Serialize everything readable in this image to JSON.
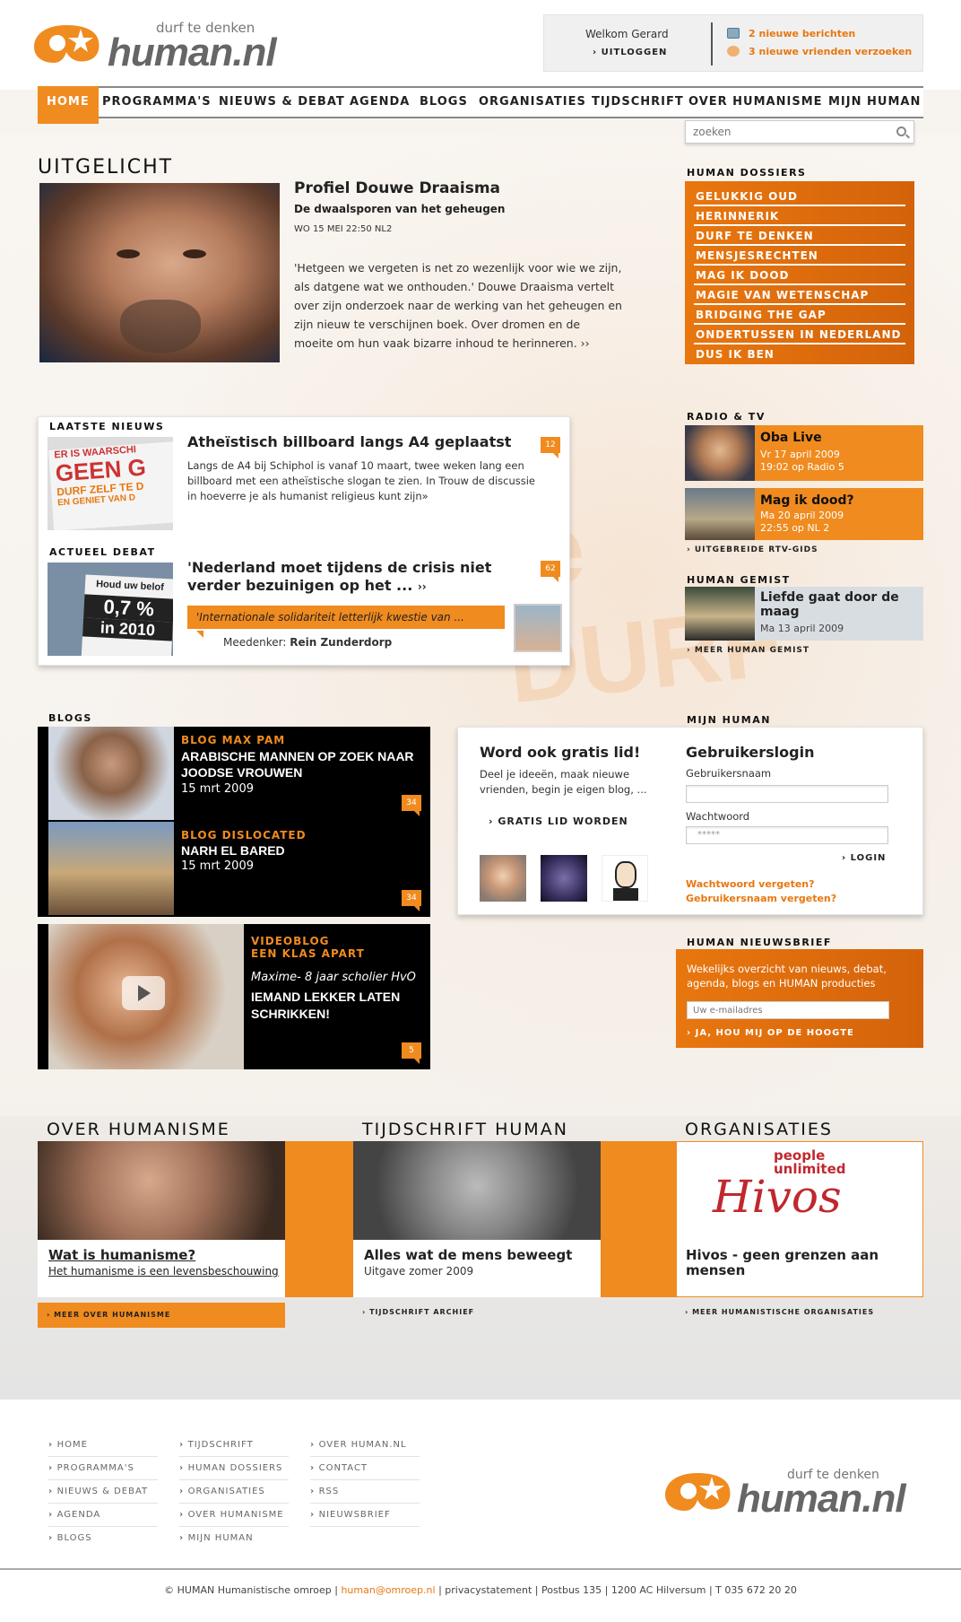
{
  "header": {
    "logo_tagline": "durf te denken",
    "logo_name": "human.nl",
    "welcome": "Welkom Gerard",
    "logout": "UITLOGGEN",
    "messages": "2 nieuwe berichten",
    "friend_requests": "3 nieuwe vrienden verzoeken"
  },
  "nav": {
    "items": [
      "HOME",
      "PROGRAMMA'S",
      "NIEUWS & DEBAT",
      "AGENDA",
      "BLOGS",
      "ORGANISATIES",
      "TIJDSCHRIFT",
      "OVER HUMANISME",
      "MIJN HUMAN"
    ],
    "active": "HOME"
  },
  "search": {
    "placeholder": "zoeken"
  },
  "featured": {
    "section_title": "UITGELICHT",
    "title": "Profiel Douwe Draaisma",
    "subtitle": "De dwaalsporen van het geheugen",
    "meta": "WO 15 MEI 22:50 NL2",
    "body": "'Hetgeen we vergeten is net zo wezenlijk voor wie we zijn, als datgene wat we onthouden.' Douwe Draaisma vertelt over zijn onderzoek naar de werking van het geheugen en zijn nieuw te verschijnen boek. Over dromen en de moeite om hun vaak bizarre inhoud te herinneren. ››"
  },
  "dossiers": {
    "label": "HUMAN DOSSIERS",
    "items": [
      "GELUKKIG OUD",
      "HERINNERIK",
      "DURF TE DENKEN",
      "MENSJESRECHTEN",
      "MAG IK DOOD",
      "MAGIE VAN WETENSCHAP",
      "BRIDGING THE GAP",
      "ONDERTUSSEN IN NEDERLAND",
      "DUS IK BEN"
    ]
  },
  "news": {
    "label": "LAATSTE NIEUWS",
    "title": "Atheïstisch billboard langs A4 geplaatst",
    "count": "12",
    "body": "Langs de A4 bij Schiphol is vanaf 10 maart, twee weken lang een billboard met een atheïstische slogan te zien. In Trouw de discussie in hoeverre je als humanist religieus kunt zijn»",
    "img_lines": [
      "ER IS WAARSCHI",
      "GEEN G",
      "DURF ZELF TE D",
      "EN GENIET VAN D"
    ]
  },
  "debate": {
    "label": "ACTUEEL DEBAT",
    "title": "'Nederland moet tijdens de crisis niet verder bezuinigen op het ...",
    "more": "››",
    "count": "62",
    "quote": "'Internationale solidariteit letterlijk kwestie van ...",
    "debater_label": "Meedenker:",
    "debater": "Rein Zunderdorp",
    "img_lines": [
      "Houd uw belof",
      "0,7 %",
      "in 2010"
    ]
  },
  "radio_tv": {
    "label": "RADIO & TV",
    "items": [
      {
        "title": "Oba Live",
        "line1": "Vr 17 april 2009",
        "line2": "19:02 op Radio 5"
      },
      {
        "title": "Mag ik dood?",
        "line1": "Ma 20 april 2009",
        "line2": "22:55 op NL 2"
      }
    ],
    "more": "UITGEBREIDE RTV-GIDS"
  },
  "gemist": {
    "label": "HUMAN GEMIST",
    "title": "Liefde gaat door de maag",
    "date": "Ma 13 april 2009",
    "more": "MEER HUMAN GEMIST"
  },
  "blogs": {
    "label": "BLOGS",
    "items": [
      {
        "category": "BLOG MAX PAM",
        "title": "ARABISCHE MANNEN OP ZOEK NAAR JOODSE VROUWEN",
        "date": "15 mrt 2009",
        "count": "34"
      },
      {
        "category": "BLOG DISLOCATED",
        "title": "NARH EL BARED",
        "date": "15 mrt 2009",
        "count": "34"
      }
    ],
    "video": {
      "category1": "VIDEOBLOG",
      "category2": "EEN KLAS APART",
      "subtitle": "Maxime- 8 jaar scholier HvO",
      "title": "IEMAND LEKKER LATEN SCHRIKKEN!",
      "count": "5"
    }
  },
  "mijn_human": {
    "label": "MIJN HUMAN",
    "join_title": "Word ook gratis lid!",
    "join_body": "Deel je ideeën, maak nieuwe vrienden, begin je eigen blog, ...",
    "join_button": "GRATIS LID WORDEN",
    "login_title": "Gebruikerslogin",
    "username_label": "Gebruikersnaam",
    "password_label": "Wachtwoord",
    "password_value": "*****",
    "login_button": "LOGIN",
    "forgot_password": "Wachtwoord vergeten?",
    "forgot_username": "Gebruikersnaam vergeten?"
  },
  "newsletter": {
    "label": "HUMAN NIEUWSBRIEF",
    "body": "Wekelijks overzicht van nieuws, debat, agenda, blogs en HUMAN producties",
    "placeholder": "Uw e-mailadres",
    "button": "JA, HOU MIJ OP DE HOOGTE"
  },
  "bottom": {
    "humanisme": {
      "label": "OVER HUMANISME",
      "title": "Wat is humanisme?",
      "subtitle": "Het humanisme is een levensbeschouwing",
      "more": "MEER OVER HUMANISME"
    },
    "tijdschrift": {
      "label": "TIJDSCHRIFT HUMAN",
      "title": "Alles wat de mens beweegt",
      "subtitle": "Uitgave zomer 2009",
      "more": "TIJDSCHRIFT ARCHIEF"
    },
    "organisaties": {
      "label": "ORGANISATIES",
      "logo_top": "people unlimited",
      "logo_name": "Hivos",
      "title": "Hivos - geen grenzen aan mensen",
      "more": "MEER HUMANISTISCHE ORGANISATIES"
    }
  },
  "footer": {
    "col1": [
      "HOME",
      "PROGRAMMA'S",
      "NIEUWS & DEBAT",
      "AGENDA",
      "BLOGS"
    ],
    "col2": [
      "TIJDSCHRIFT",
      "HUMAN DOSSIERS",
      "ORGANISATIES",
      "OVER HUMANISME",
      "MIJN HUMAN"
    ],
    "col3": [
      "OVER HUMAN.NL",
      "CONTACT",
      "RSS",
      "NIEUWSBRIEF"
    ],
    "copyright_pre": "© HUMAN Humanistische omroep |",
    "email": "human@omroep.nl",
    "copyright_post": "| privacystatement | Postbus 135 | 1200 AC Hilversum | T 035 672 20 20"
  },
  "colors": {
    "accent": "#f08b1f",
    "accent_dark": "#d4620a",
    "text": "#222222"
  }
}
